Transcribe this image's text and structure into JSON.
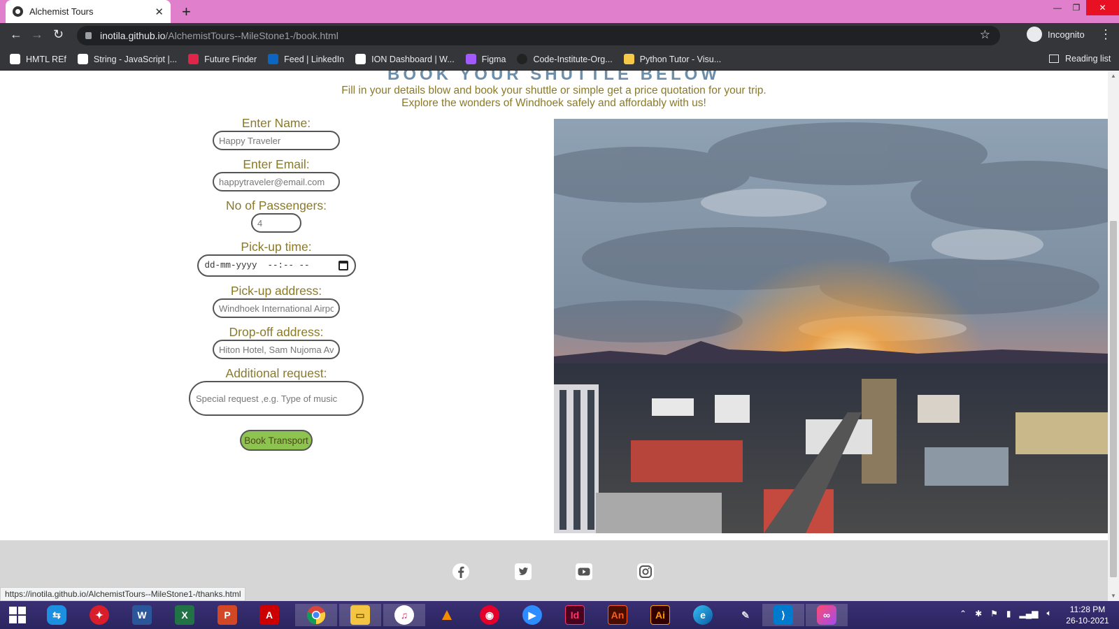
{
  "browser": {
    "tab_title": "Alchemist Tours",
    "url_host": "inotila.github.io",
    "url_path": "/AlchemistTours--MileStone1-/book.html",
    "profile_label": "Incognito",
    "bookmarks": [
      {
        "label": "HMTL REf",
        "color": "#ffffff"
      },
      {
        "label": "String - JavaScript |...",
        "color": "#ffffff"
      },
      {
        "label": "Future Finder",
        "color": "#e0244a"
      },
      {
        "label": "Feed | LinkedIn",
        "color": "#0a66c2"
      },
      {
        "label": "ION Dashboard | W...",
        "color": "#ffffff"
      },
      {
        "label": "Figma",
        "color": "#a259ff"
      },
      {
        "label": "Code-Institute-Org...",
        "color": "#222222"
      },
      {
        "label": "Python Tutor - Visu...",
        "color": "#f7c948"
      }
    ],
    "reading_list_label": "Reading list",
    "status_url": "https://inotila.github.io/AlchemistTours--MileStone1-/thanks.html"
  },
  "page": {
    "heading": "BOOK YOUR SHUTTLE BELOW",
    "intro_line1": "Fill in your details blow and book your shuttle or simple get a price quotation for your trip.",
    "intro_line2": "Explore the wonders of Windhoek safely and affordably with us!"
  },
  "form": {
    "name_label": "Enter Name:",
    "name_placeholder": "Happy Traveler",
    "email_label": "Enter Email:",
    "email_placeholder": "happytraveler@email.com",
    "passengers_label": "No of Passengers:",
    "passengers_placeholder": "4",
    "pickup_time_label": "Pick-up time:",
    "pickup_time_value": "dd-mm-yyyy  --:-- --",
    "pickup_address_label": "Pick-up address:",
    "pickup_address_placeholder": "Windhoek International Airport",
    "dropoff_address_label": "Drop-off address:",
    "dropoff_address_placeholder": "Hiton Hotel, Sam Nujoma Ave",
    "request_label": "Additional request:",
    "request_placeholder": "Special request ,e.g. Type of music",
    "submit_label": "Book Transport",
    "accent_color": "#8dc34f",
    "label_color": "#8a7a28"
  },
  "footer": {
    "social_icons": [
      "facebook-icon",
      "twitter-icon",
      "youtube-icon",
      "instagram-icon"
    ]
  },
  "taskbar": {
    "apps": [
      "start",
      "teamviewer",
      "antivirus",
      "word",
      "excel",
      "powerpoint",
      "acrobat",
      "chrome",
      "file-explorer",
      "itunes",
      "vlc",
      "screen-recorder",
      "zoom",
      "indesign",
      "animate",
      "illustrator",
      "edge",
      "pen-tool",
      "vs-code",
      "creative-cloud"
    ],
    "time": "11:28 PM",
    "date": "26-10-2021"
  }
}
